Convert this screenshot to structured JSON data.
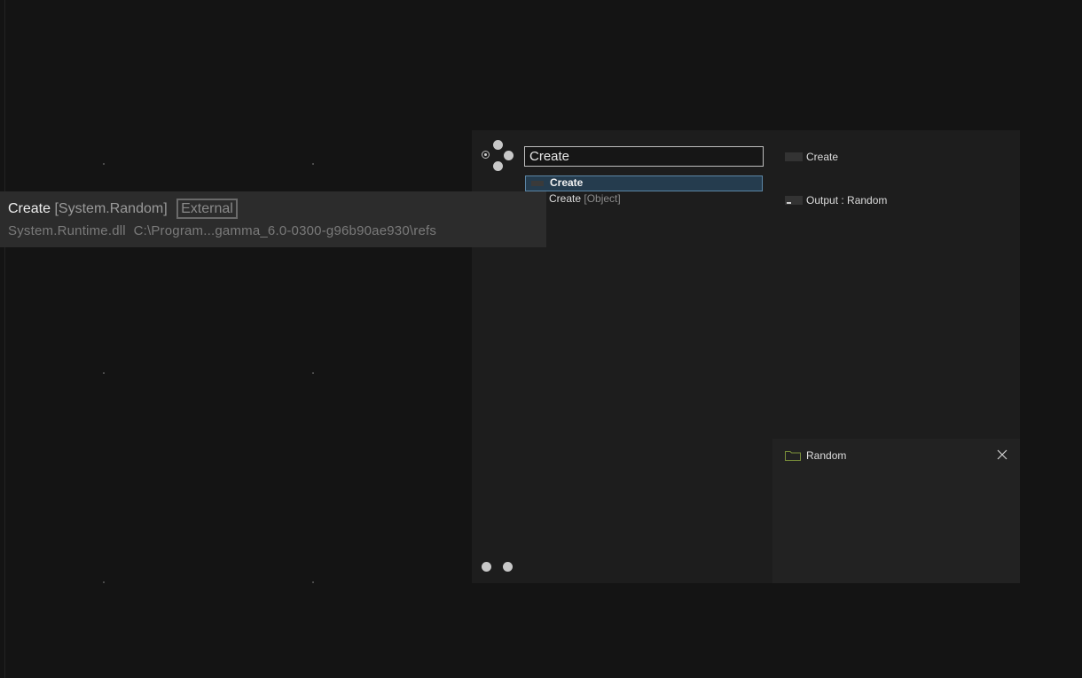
{
  "search": {
    "value": "Create"
  },
  "results": [
    {
      "label": "Create",
      "sub": "",
      "selected": true
    },
    {
      "label": "Create",
      "sub": "[Object]",
      "selected": false
    }
  ],
  "details": {
    "item1": "Create",
    "item2": "Output : Random"
  },
  "folder": {
    "label": "Random",
    "icon": "folder-icon",
    "color": "#7a8f3a"
  },
  "tooltip": {
    "name": "Create",
    "type": "[System.Random]",
    "badge": "External",
    "assembly": "System.Runtime.dll",
    "path": "C:\\Program...gamma_6.0-0300-g96b90ae930\\refs"
  }
}
